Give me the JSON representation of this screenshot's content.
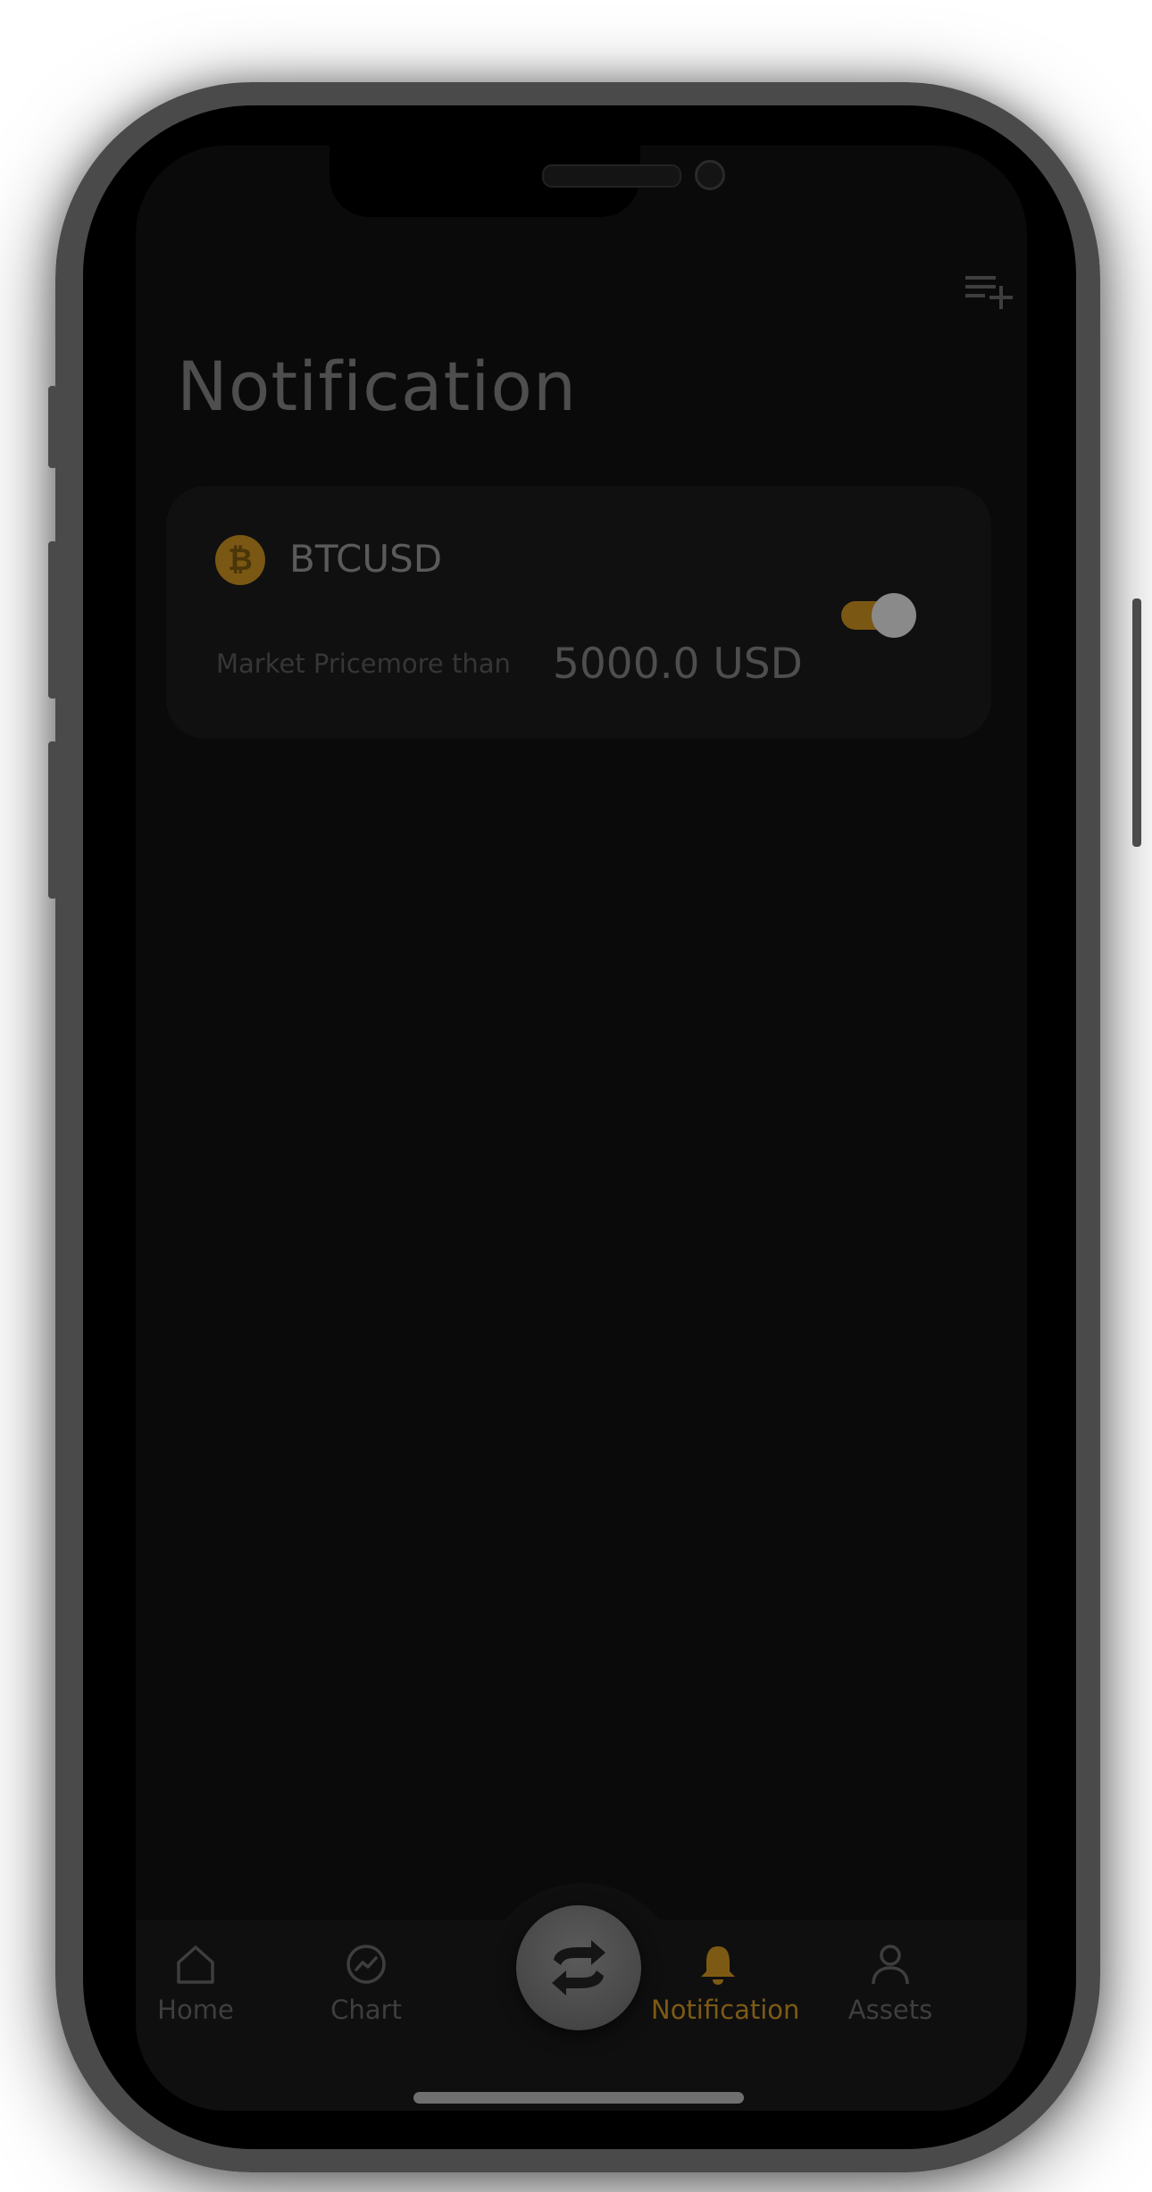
{
  "header": {
    "title": "Notification",
    "add_alert_icon": "playlist-add-icon"
  },
  "alerts": [
    {
      "coin_icon": "bitcoin-icon",
      "coin_symbol": "₿",
      "pair": "BTCUSD",
      "condition": "Market Pricemore than",
      "value": "5000.0 USD",
      "enabled": true
    }
  ],
  "tab_bar": {
    "items": [
      {
        "label": "Home",
        "icon": "home-icon",
        "active": false
      },
      {
        "label": "Chart",
        "icon": "chart-icon",
        "active": false
      },
      {
        "label": "Notification",
        "icon": "bell-icon",
        "active": true
      },
      {
        "label": "Assets",
        "icon": "user-icon",
        "active": false
      }
    ],
    "center_button_icon": "swap-icon"
  },
  "colors": {
    "accent": "#7d5a14",
    "background": "#0a0a0a",
    "card": "#101010",
    "device_frame": "#4a4a4a"
  }
}
